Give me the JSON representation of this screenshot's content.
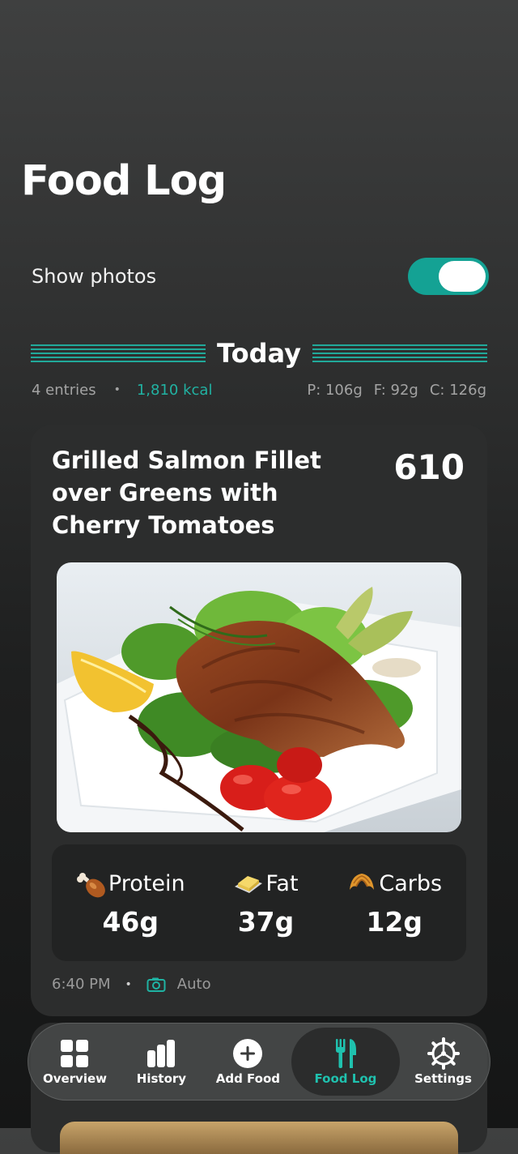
{
  "header": {
    "title": "Food Log"
  },
  "settings": {
    "show_photos_label": "Show photos",
    "show_photos_enabled": true
  },
  "day": {
    "label": "Today",
    "entries": "4 entries",
    "kcal": "1,810 kcal",
    "protein": "P: 106g",
    "fat": "F: 92g",
    "carbs": "C: 126g"
  },
  "entry": {
    "title": "Grilled Salmon Fillet over Greens with Cherry Tomatoes",
    "calories": "610",
    "photo_icon": "grilled-salmon-photo",
    "macros": {
      "protein_label": "Protein",
      "protein_value": "46g",
      "fat_label": "Fat",
      "fat_value": "37g",
      "carbs_label": "Carbs",
      "carbs_value": "12g"
    },
    "time": "6:40 PM",
    "source": "Auto"
  },
  "tabs": [
    {
      "label": "Overview",
      "icon": "grid-icon",
      "active": false
    },
    {
      "label": "History",
      "icon": "bar-chart-icon",
      "active": false
    },
    {
      "label": "Add Food",
      "icon": "plus-circle-icon",
      "active": false
    },
    {
      "label": "Food Log",
      "icon": "fork-knife-icon",
      "active": true
    },
    {
      "label": "Settings",
      "icon": "gear-icon",
      "active": false
    }
  ],
  "colors": {
    "accent": "#21a99a",
    "card": "#2c2d2d"
  }
}
